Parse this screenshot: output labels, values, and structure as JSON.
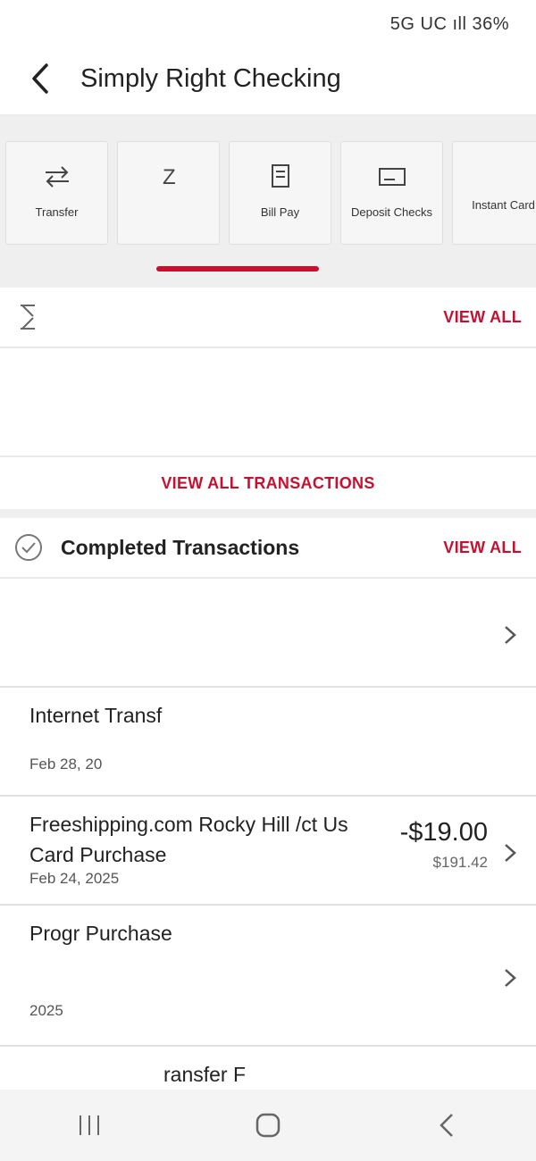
{
  "status_bar": {
    "text": "5G UC ıll 36%"
  },
  "header": {
    "title": "Simply Right Checking"
  },
  "actions": [
    {
      "label": "Transfer",
      "icon": "transfer-icon"
    },
    {
      "label": "",
      "icon": "zelle-icon"
    },
    {
      "label": "Bill Pay",
      "icon": "bill-pay-icon"
    },
    {
      "label": "Deposit Checks",
      "icon": "deposit-icon"
    },
    {
      "label": "Instant Card",
      "icon": "card-icon"
    }
  ],
  "pending": {
    "title": "",
    "view_all": "VIEW ALL",
    "view_all_transactions": "VIEW ALL TRANSACTIONS"
  },
  "completed": {
    "title": "Completed Transactions",
    "view_all": "VIEW ALL",
    "transactions": [
      {
        "desc": "",
        "amount": "",
        "balance": "",
        "date": ""
      },
      {
        "desc": "Internet Transf",
        "amount": "",
        "balance": "",
        "date": "Feb 28, 20"
      },
      {
        "desc": "Freeshipping.com Rocky Hill /ct Us Card Purchase",
        "amount": "-$19.00",
        "balance": "$191.42",
        "date": "Feb 24, 2025"
      },
      {
        "desc": "Progr Purchase",
        "amount": "",
        "balance": "",
        "date": "2025"
      },
      {
        "desc": "ransfer F",
        "amount": "",
        "balance": "",
        "date": ""
      }
    ]
  },
  "colors": {
    "accent": "#c8102e"
  }
}
